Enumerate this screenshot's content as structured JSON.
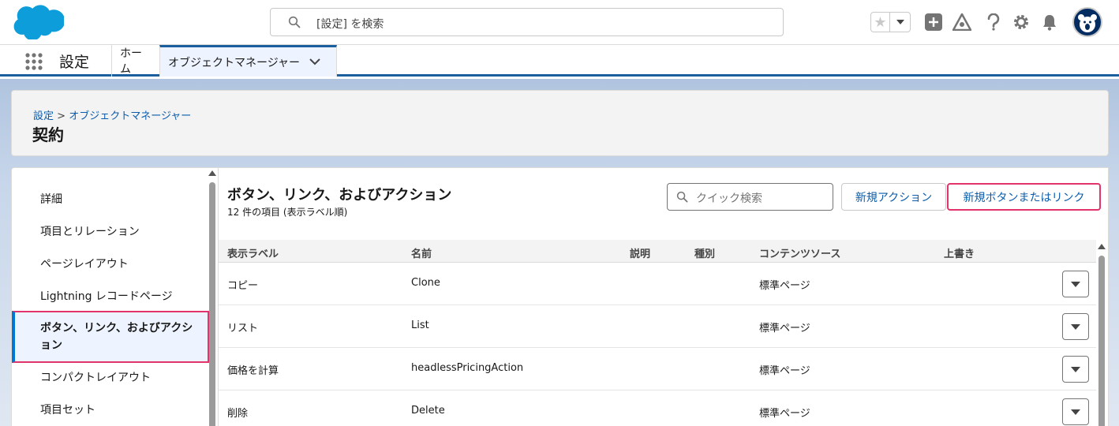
{
  "header": {
    "search_placeholder": "[設定] を検索",
    "icons": [
      "salesforce-cloud-logo",
      "search-icon",
      "star-icon",
      "chevron-down-icon",
      "plus-icon",
      "trailhead-icon",
      "help-icon",
      "gear-icon",
      "bell-icon",
      "avatar"
    ]
  },
  "nav": {
    "app_name": "設定",
    "tabs": [
      {
        "label": "ホーム"
      },
      {
        "label": "オブジェクトマネージャー"
      }
    ]
  },
  "page": {
    "breadcrumb_root": "設定",
    "breadcrumb_sep": ">",
    "breadcrumb_current": "オブジェクトマネージャー",
    "title": "契約"
  },
  "sidebar": {
    "items": [
      {
        "label": "詳細"
      },
      {
        "label": "項目とリレーション"
      },
      {
        "label": "ページレイアウト"
      },
      {
        "label": "Lightning レコードページ"
      },
      {
        "label": "ボタン、リンク、およびアクション"
      },
      {
        "label": "コンパクトレイアウト"
      },
      {
        "label": "項目セット"
      }
    ]
  },
  "main": {
    "title": "ボタン、リンク、およびアクション",
    "subtitle": "12 件の項目 (表示ラベル順)",
    "quick_search_placeholder": "クイック検索",
    "new_action_label": "新規アクション",
    "new_button_label": "新規ボタンまたはリンク",
    "columns": [
      "表示ラベル",
      "名前",
      "説明",
      "種別",
      "コンテンツソース",
      "上書き"
    ],
    "rows": [
      {
        "label": "コピー",
        "name": "Clone",
        "source": "標準ページ"
      },
      {
        "label": "リスト",
        "name": "List",
        "source": "標準ページ"
      },
      {
        "label": "価格を計算",
        "name": "headlessPricingAction",
        "source": "標準ページ"
      },
      {
        "label": "削除",
        "name": "Delete",
        "source": "標準ページ"
      }
    ]
  },
  "colors": {
    "brand_blue": "#0176d3",
    "link_blue": "#0b5cab",
    "highlight_pink": "#e3336b",
    "nav_border": "#1b5f9e"
  }
}
